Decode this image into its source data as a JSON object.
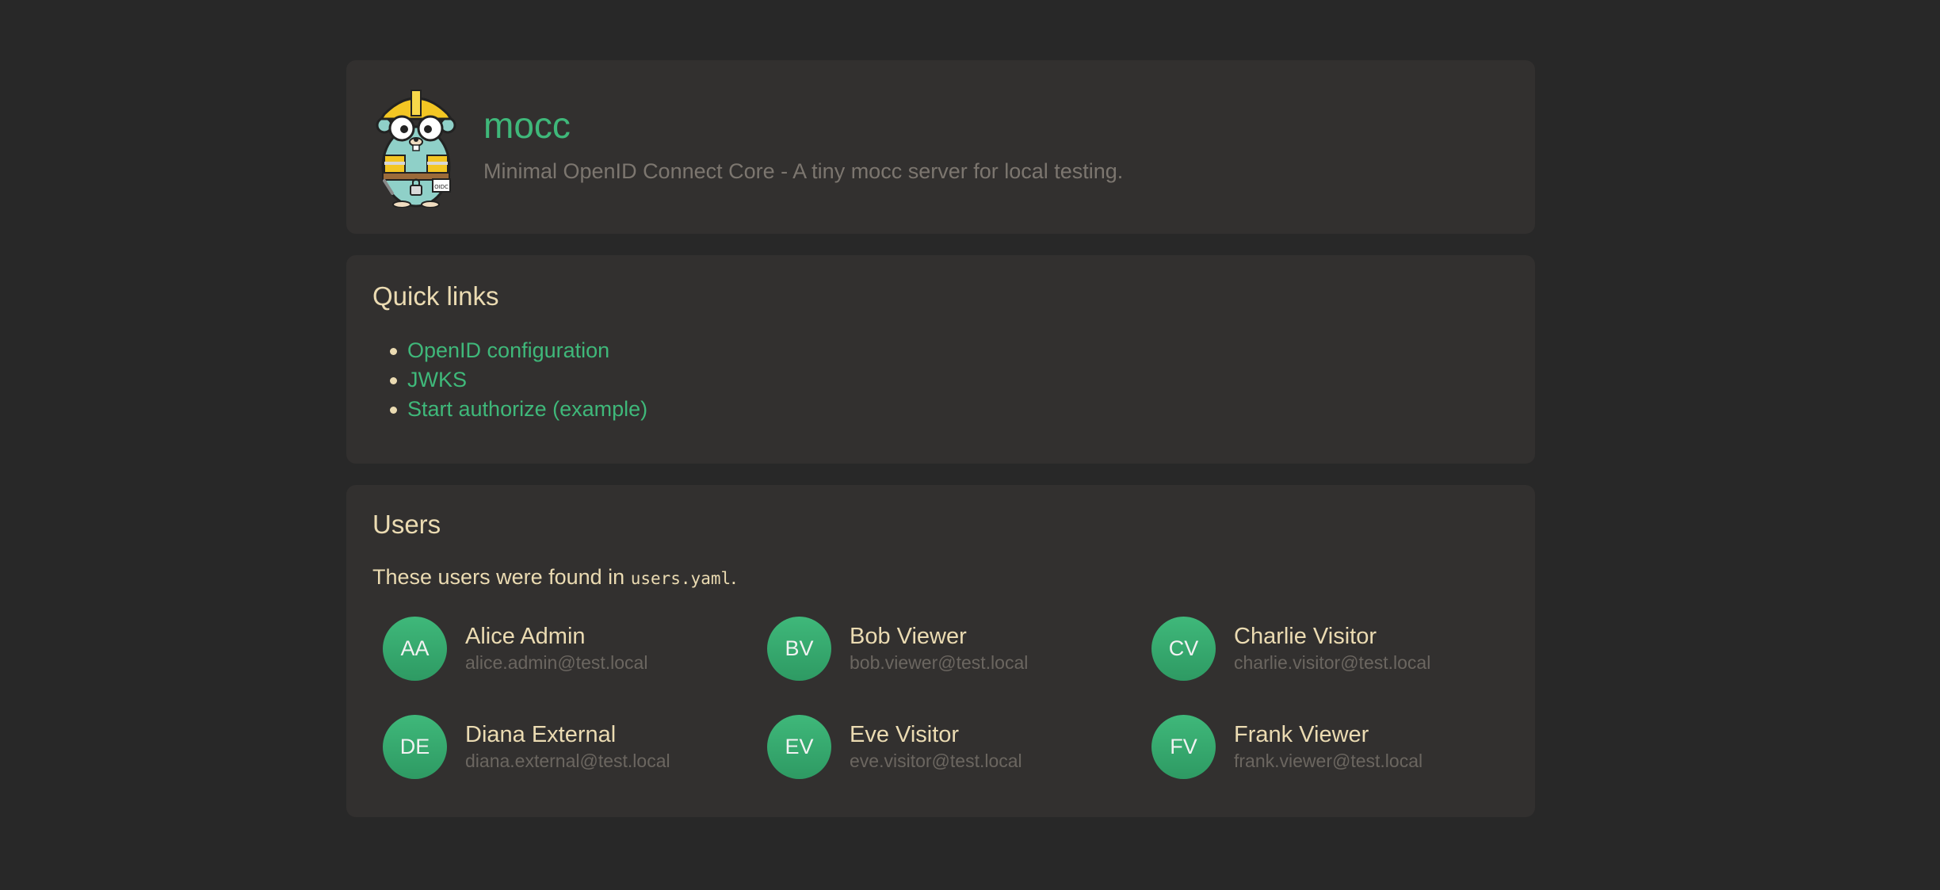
{
  "header": {
    "title": "mocc",
    "subtitle": "Minimal OpenID Connect Core - A tiny mocc server for local testing.",
    "mascot_icon": "gopher-mascot-icon",
    "mascot_badge": "OIDC"
  },
  "quick_links": {
    "title": "Quick links",
    "items": [
      {
        "label": "OpenID configuration"
      },
      {
        "label": "JWKS"
      },
      {
        "label": "Start authorize (example)"
      }
    ]
  },
  "users": {
    "title": "Users",
    "description_prefix": "These users were found in ",
    "description_file": "users.yaml",
    "description_suffix": ".",
    "list": [
      {
        "initials": "AA",
        "name": "Alice Admin",
        "email": "alice.admin@test.local"
      },
      {
        "initials": "BV",
        "name": "Bob Viewer",
        "email": "bob.viewer@test.local"
      },
      {
        "initials": "CV",
        "name": "Charlie Visitor",
        "email": "charlie.visitor@test.local"
      },
      {
        "initials": "DE",
        "name": "Diana External",
        "email": "diana.external@test.local"
      },
      {
        "initials": "EV",
        "name": "Eve Visitor",
        "email": "eve.visitor@test.local"
      },
      {
        "initials": "FV",
        "name": "Frank Viewer",
        "email": "frank.viewer@test.local"
      }
    ]
  },
  "colors": {
    "background": "#282828",
    "card": "#32302f",
    "accent": "#3fb87a",
    "text": "#ebdbb2",
    "muted": "#7c766f"
  }
}
